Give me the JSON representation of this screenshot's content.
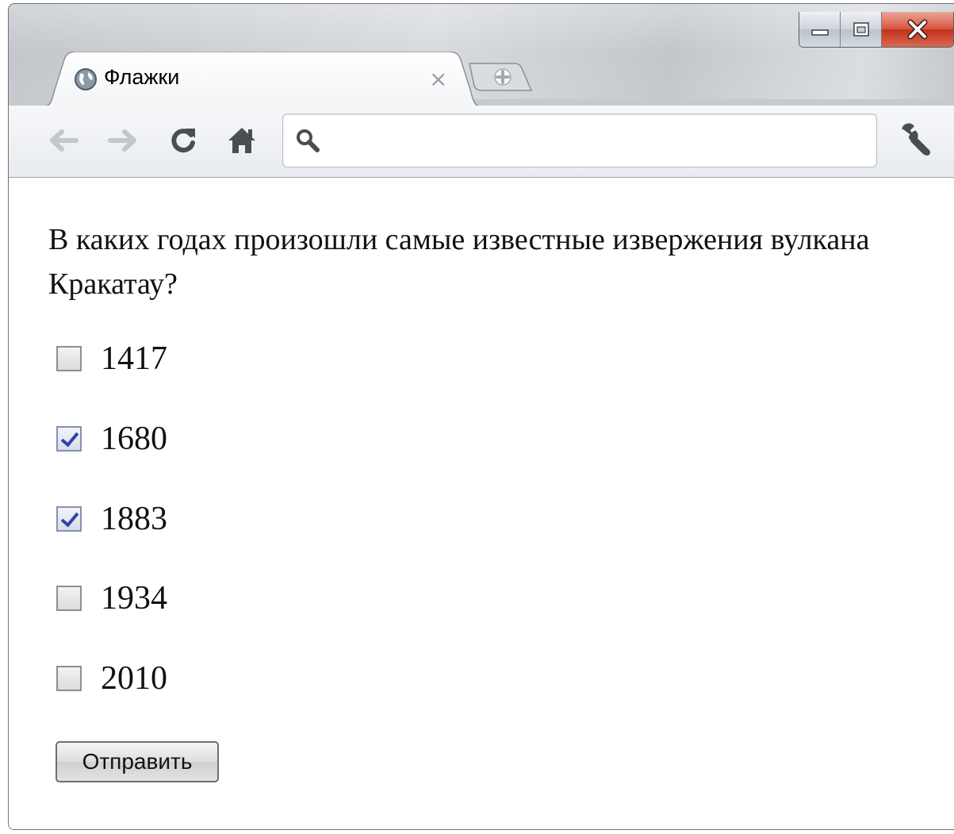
{
  "window": {
    "controls": [
      "minimize-icon",
      "maximize-icon",
      "close-icon"
    ]
  },
  "tab": {
    "title": "Флажки",
    "close_glyph": "×",
    "favicon": "globe-icon"
  },
  "toolbar": {
    "back": "back-arrow-icon",
    "forward": "forward-arrow-icon",
    "reload": "reload-icon",
    "home": "home-icon",
    "omnibox_value": "",
    "menu": "wrench-icon"
  },
  "content": {
    "question": "В каких годах произошли самые известные извержения вулкана Кракатау?",
    "options": [
      {
        "label": "1417",
        "checked": false
      },
      {
        "label": "1680",
        "checked": true
      },
      {
        "label": "1883",
        "checked": true
      },
      {
        "label": "1934",
        "checked": false
      },
      {
        "label": "2010",
        "checked": false
      }
    ],
    "submit_label": "Отправить"
  },
  "colors": {
    "close_button": "#d04a35",
    "checkmark": "#3342a0"
  }
}
